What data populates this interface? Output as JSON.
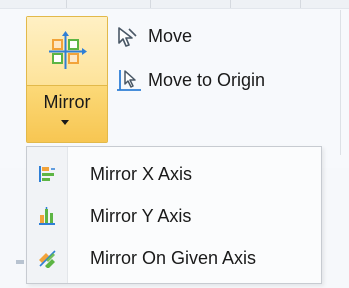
{
  "ribbon": {
    "mirror_button": {
      "label": "Mirror",
      "icon": "mirror-icon",
      "dropdown_icon": "chevron-down-icon",
      "state": "pressed"
    },
    "move_button": {
      "label": "Move",
      "icon": "move-cursor-icon"
    },
    "move_to_origin_button": {
      "label": "Move to Origin",
      "icon": "move-to-origin-icon"
    }
  },
  "dropdown": {
    "items": [
      {
        "label": "Mirror X Axis",
        "icon": "mirror-x-axis-icon"
      },
      {
        "label": "Mirror Y Axis",
        "icon": "mirror-y-axis-icon"
      },
      {
        "label": "Mirror On Given Axis",
        "icon": "mirror-given-axis-icon"
      }
    ]
  },
  "colors": {
    "accent_hover": "#fde39a",
    "accent_border": "#e2b94a",
    "icon_orange": "#f2a33a",
    "icon_green": "#5db544",
    "icon_blue": "#2f7fd6"
  }
}
